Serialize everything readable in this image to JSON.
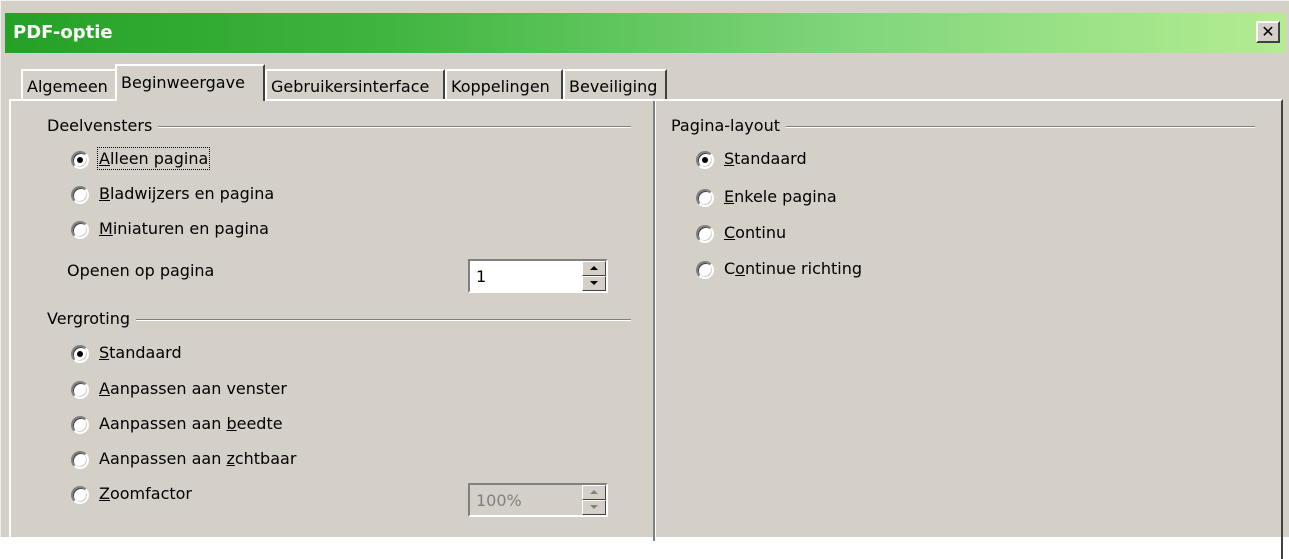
{
  "window": {
    "title": "PDF-optie",
    "close_label": "✕"
  },
  "tabs": [
    {
      "label": "Algemeen",
      "active": false
    },
    {
      "label": "Beginweergave",
      "active": true
    },
    {
      "label": "Gebruikersinterface",
      "active": false
    },
    {
      "label": "Koppelingen",
      "active": false
    },
    {
      "label": "Beveiliging",
      "active": false
    }
  ],
  "deelvensters": {
    "title": "Deelvensters",
    "options": [
      {
        "label": "Alleen pagina",
        "checked": true
      },
      {
        "label": "Bladwijzers en pagina",
        "checked": false
      },
      {
        "label": "Miniaturen en pagina",
        "checked": false
      }
    ],
    "open_on_page_label": "Openen op pagina",
    "open_on_page_value": "1"
  },
  "vergroting": {
    "title": "Vergroting",
    "options": [
      {
        "label": "Standaard",
        "checked": true
      },
      {
        "label": "Aanpassen aan venster",
        "checked": false
      },
      {
        "label": "Aanpassen aan breedte",
        "checked": false
      },
      {
        "label": "Aanpassen aan zichtbaar",
        "checked": false
      },
      {
        "label": "Zoomfactor",
        "checked": false
      }
    ],
    "zoom_value": "100%"
  },
  "pagina_layout": {
    "title": "Pagina-layout",
    "options": [
      {
        "label": "Standaard",
        "checked": true
      },
      {
        "label": "Enkele pagina",
        "checked": false
      },
      {
        "label": "Continu",
        "checked": false
      },
      {
        "label": "Continue richting",
        "checked": false
      }
    ]
  }
}
